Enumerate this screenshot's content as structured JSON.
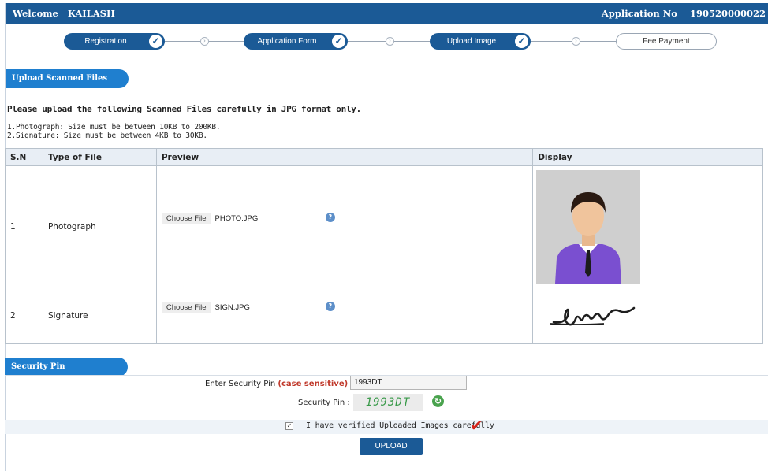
{
  "header": {
    "welcome_label": "Welcome",
    "user_name": "KAILASH",
    "app_no_label": "Application No",
    "app_no_value": "190520000022"
  },
  "steps": [
    {
      "label": "Registration",
      "completed": true
    },
    {
      "label": "Application Form",
      "completed": true
    },
    {
      "label": "Upload Image",
      "completed": true
    },
    {
      "label": "Fee Payment",
      "completed": false
    }
  ],
  "upload_section": {
    "tab_label": "Upload Scanned Files",
    "title": "Please upload the following Scanned Files carefully in JPG format only.",
    "instructions": [
      "1.Photograph: Size must be between 10KB to 200KB.",
      "2.Signature: Size must be between 4KB to 30KB."
    ],
    "columns": [
      "S.N",
      "Type of File",
      "Preview",
      "Display"
    ],
    "rows": [
      {
        "sn": "1",
        "type": "Photograph",
        "button": "Choose File",
        "filename": "PHOTO.JPG"
      },
      {
        "sn": "2",
        "type": "Signature",
        "button": "Choose File",
        "filename": "SIGN.JPG"
      }
    ]
  },
  "security_section": {
    "tab_label": "Security Pin",
    "enter_label": "Enter Security Pin",
    "case_sensitive": "(case sensitive)",
    "colon": ":",
    "input_value": "1993DT",
    "pin_label": "Security Pin :",
    "captcha": "1993DT",
    "verify_text": "I have verified Uploaded Images carefully",
    "verified": true,
    "upload_button": "UPLOAD"
  },
  "colors": {
    "header_blue": "#1b5a96",
    "tab_blue": "#1f7fcf",
    "case_sensitive_red": "#c0392b",
    "captcha_green": "#3a9a4a"
  }
}
